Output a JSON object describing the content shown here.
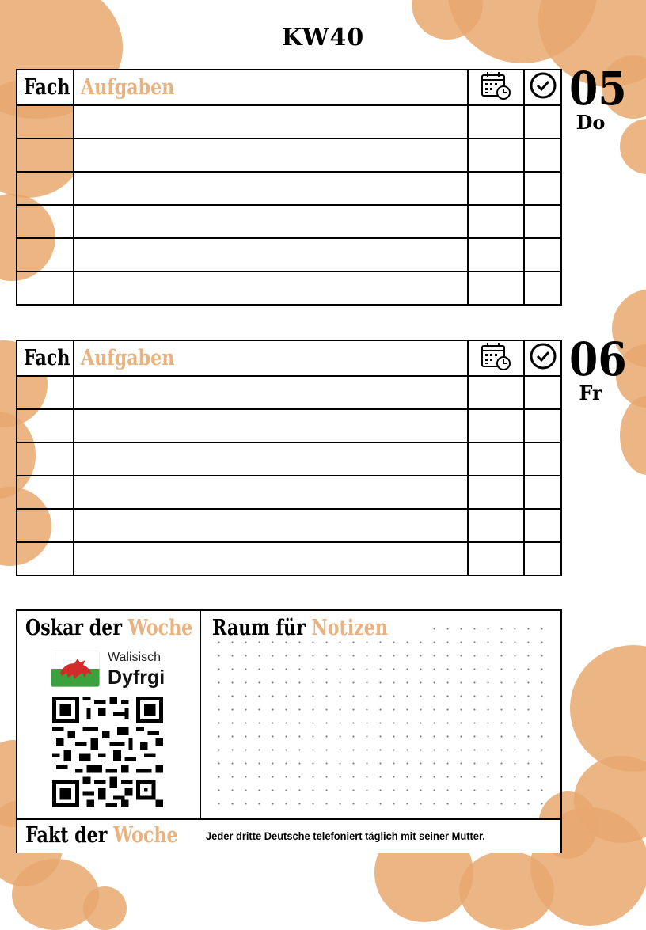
{
  "title": "KW40",
  "days": [
    {
      "number": "05",
      "name": "Do",
      "header": {
        "subject": "Fach",
        "tasks": "Aufgaben",
        "due_icon": "calendar-clock-icon",
        "done_icon": "check-circle-icon"
      },
      "rows": 6
    },
    {
      "number": "06",
      "name": "Fr",
      "header": {
        "subject": "Fach",
        "tasks": "Aufgaben",
        "due_icon": "calendar-clock-icon",
        "done_icon": "check-circle-icon"
      },
      "rows": 6
    }
  ],
  "oskar": {
    "title_part1": "Oskar der",
    "title_part2": "Woche",
    "language": "Walisisch",
    "word": "Dyfrgi",
    "flag_icon": "wales-flag-icon",
    "qr_icon": "qr-code-icon"
  },
  "notes": {
    "title_part1": "Raum für",
    "title_part2": "Notizen"
  },
  "fact": {
    "title_part1": "Fakt der",
    "title_part2": "Woche",
    "text": "Jeder dritte Deutsche telefoniert täglich mit seiner Mutter."
  },
  "colors": {
    "accent": "#e9b27e",
    "bubbles": "#e7a86e"
  }
}
